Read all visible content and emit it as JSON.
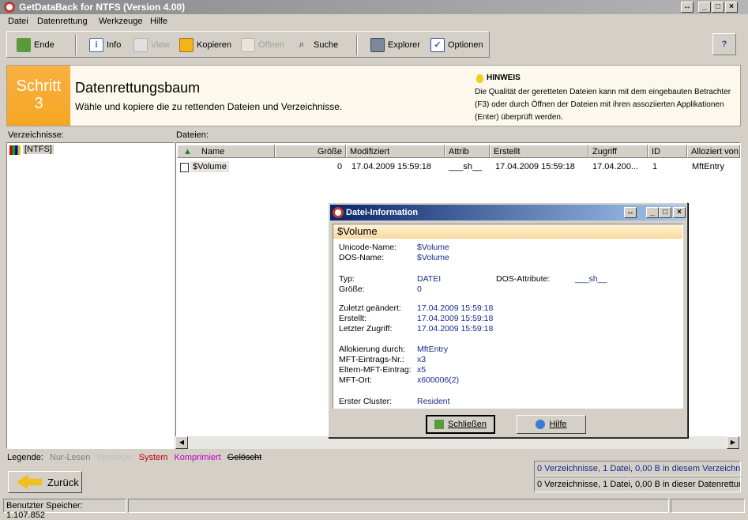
{
  "window": {
    "title": "GetDataBack for NTFS (Version 4.00)",
    "resize_glyph": "↔",
    "min_glyph": "_",
    "max_glyph": "□",
    "close_glyph": "×"
  },
  "menu": [
    {
      "label": "Datei"
    },
    {
      "label": "Datenrettung"
    },
    {
      "label": "Werkzeuge"
    },
    {
      "label": "Hilfe"
    }
  ],
  "toolbar": {
    "exit": "Ende",
    "info": "Info",
    "view": "View",
    "copy": "Kopieren",
    "open": "Öffnen",
    "search": "Suche",
    "explorer": "Explorer",
    "options": "Optionen",
    "help_glyph": "?"
  },
  "header": {
    "step_label": "Schritt",
    "step_num": "3",
    "title": "Datenrettungsbaum",
    "subtitle": "Wähle und kopiere die zu rettenden Dateien und Verzeichnisse.",
    "hint_label": "HINWEIS",
    "hint_text": "Die Qualität der geretteten Dateien kann mit dem eingebauten Betrachter (F3) oder durch Öffnen der Dateien mit ihren assoziierten Applikationen (Enter) überprüft werden."
  },
  "left": {
    "label": "Verzeichnisse:",
    "tree_root": "[NTFS]"
  },
  "files": {
    "label": "Dateien:",
    "columns": [
      "Name",
      "Größe",
      "Modifiziert",
      "Attrib",
      "Erstellt",
      "Zugriff",
      "ID",
      "Alloziert von"
    ],
    "rows": [
      {
        "name": "$Volume",
        "size": "0",
        "modified": "17.04.2009 15:59:18",
        "attrib": "___sh__",
        "created": "17.04.2009 15:59:18",
        "accessed": "17.04.200...",
        "id": "1",
        "alloc": "MftEntry"
      }
    ]
  },
  "legend": {
    "label": "Legende:",
    "items": [
      "Nur-Lesen",
      "Versteckt",
      "System",
      "Komprimiert",
      "Gelöscht"
    ],
    "colors": [
      "#808080",
      "#c0c0c0",
      "#c00000",
      "#c000c0",
      "#000000"
    ]
  },
  "back_label": "Zurück",
  "status": {
    "line1": "0 Verzeichnisse, 1 Datei, 0,00 B in diesem Verzeichnis",
    "line2": "0 Verzeichnisse, 1 Datei, 0,00 B in dieser Datenrettung",
    "memory": "Benutzter Speicher: 1.107.852"
  },
  "dialog": {
    "title": "Datei-Information",
    "resize_glyph": "↔",
    "min_glyph": "_",
    "max_glyph": "□",
    "close_glyph": "×",
    "file": "$Volume",
    "fields": [
      {
        "label": "Unicode-Name:",
        "value": "$Volume"
      },
      {
        "label": "DOS-Name:",
        "value": "$Volume"
      },
      {
        "label": "Typ:",
        "value": "DATEI"
      },
      {
        "label": "Größe:",
        "value": "0"
      },
      {
        "label": "Zuletzt geändert:",
        "value": "17.04.2009 15:59:18"
      },
      {
        "label": "Erstellt:",
        "value": "17.04.2009 15:59:18"
      },
      {
        "label": "Letzter Zugriff:",
        "value": "17.04.2009 15:59:18"
      },
      {
        "label": "Allokierung durch:",
        "value": "MftEntry"
      },
      {
        "label": "MFT-Eintrags-Nr.:",
        "value": "x3"
      },
      {
        "label": "Eltern-MFT-Eintrag:",
        "value": "x5"
      },
      {
        "label": "MFT-Ort:",
        "value": "x600006(2)"
      },
      {
        "label": "Erster Cluster:",
        "value": "Resident"
      }
    ],
    "dos_attr_label": "DOS-Attribute:",
    "dos_attr_value": "___sh__",
    "close_button": "Schließen",
    "help_button": "Hilfe"
  }
}
